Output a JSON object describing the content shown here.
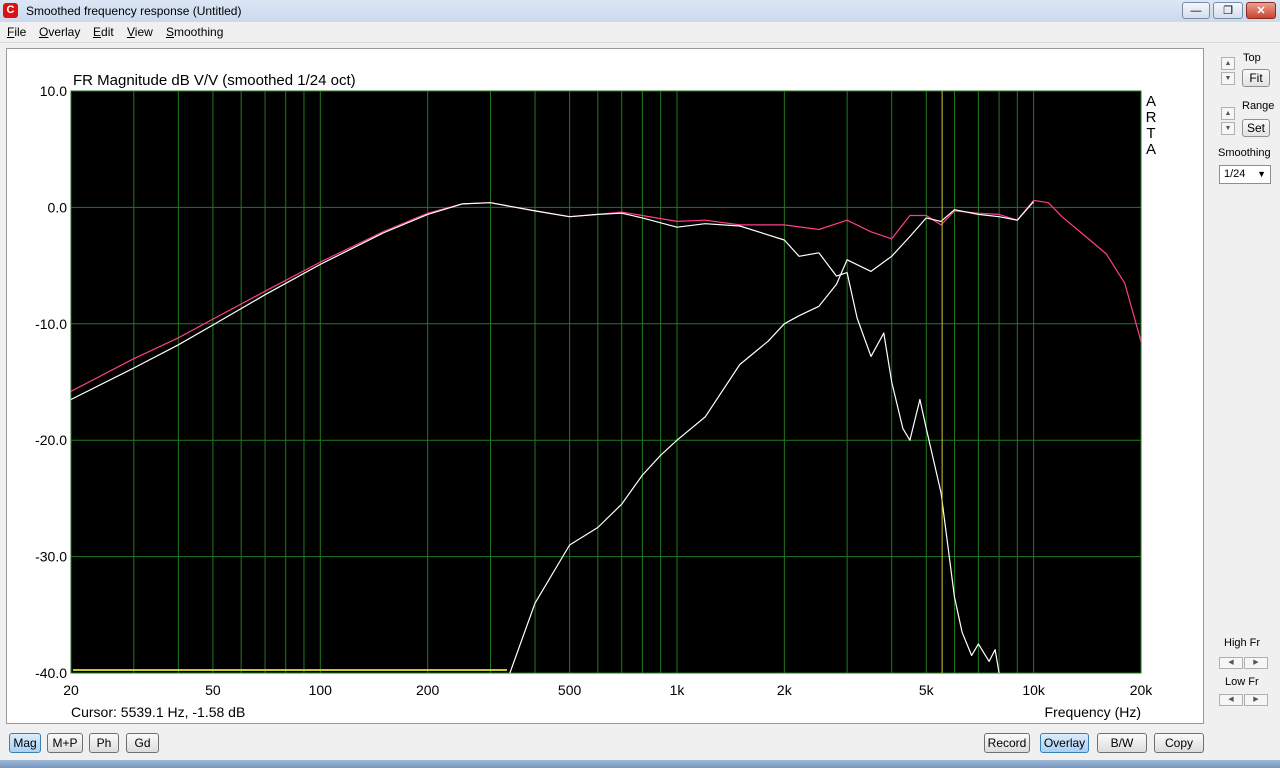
{
  "window": {
    "title": "Smoothed frequency response (Untitled)",
    "minimize": "—",
    "restore": "❐",
    "close": "✕"
  },
  "menu": [
    {
      "label": "File",
      "u": "F",
      "rest": "ile"
    },
    {
      "label": "Overlay",
      "u": "O",
      "rest": "verlay"
    },
    {
      "label": "Edit",
      "u": "E",
      "rest": "dit"
    },
    {
      "label": "View",
      "u": "V",
      "rest": "iew"
    },
    {
      "label": "Smoothing",
      "u": "S",
      "rest": "moothing"
    }
  ],
  "side": {
    "top_label": "Top",
    "fit": "Fit",
    "range_label": "Range",
    "set": "Set",
    "smoothing_label": "Smoothing",
    "smoothing_value": "1/24",
    "high_label": "High Fr",
    "low_label": "Low Fr"
  },
  "bottom_buttons": {
    "mag": "Mag",
    "mp": "M+P",
    "ph": "Ph",
    "gd": "Gd",
    "record": "Record",
    "overlay": "Overlay",
    "bw": "B/W",
    "copy": "Copy"
  },
  "status": {
    "cursor": "Cursor: 5539.1 Hz, -1.58 dB"
  },
  "colors": {
    "plot_bg": "#000000",
    "grid": "#1f7a1f",
    "white_curve": "#ffffff",
    "pink_curve": "#ff3c8c",
    "cursor": "#c8c832",
    "lowfr_marker": "#c8c832"
  },
  "chart_data": {
    "type": "line",
    "title": "FR Magnitude dB V/V (smoothed 1/24 oct)",
    "xlabel": "Frequency (Hz)",
    "ylabel": "",
    "xscale": "log",
    "xlim": [
      20,
      20000
    ],
    "ylim": [
      -40,
      10
    ],
    "x_ticks": [
      20,
      50,
      100,
      200,
      500,
      1000,
      2000,
      5000,
      10000,
      20000
    ],
    "x_tick_labels": [
      "20",
      "50",
      "100",
      "200",
      "500",
      "1k",
      "2k",
      "5k",
      "10k",
      "20k"
    ],
    "y_ticks": [
      10,
      0,
      -10,
      -20,
      -30,
      -40
    ],
    "y_tick_labels": [
      "10.0",
      "0.0",
      "-10.0",
      "-20.0",
      "-30.0",
      "-40.0"
    ],
    "watermark": [
      "A",
      "R",
      "T",
      "A"
    ],
    "cursor_x": 5539.1,
    "series": [
      {
        "color": "#ff3c8c",
        "x": [
          20,
          30,
          40,
          50,
          70,
          100,
          150,
          200,
          250,
          300,
          400,
          500,
          600,
          700,
          800,
          1000,
          1200,
          1500,
          2000,
          2500,
          3000,
          3500,
          4000,
          4500,
          5000,
          5500,
          6000,
          7000,
          8000,
          9000,
          10000,
          11000,
          12000,
          14000,
          16000,
          18000,
          20000
        ],
        "values": [
          -15.8,
          -13.0,
          -11.2,
          -9.6,
          -7.2,
          -4.7,
          -2.1,
          -0.5,
          0.3,
          0.4,
          -0.3,
          -0.8,
          -0.6,
          -0.4,
          -0.7,
          -1.2,
          -1.1,
          -1.5,
          -1.5,
          -1.9,
          -1.1,
          -2.1,
          -2.7,
          -0.7,
          -0.7,
          -1.5,
          -0.3,
          -0.5,
          -0.6,
          -1.1,
          0.6,
          0.4,
          -0.8,
          -2.5,
          -4.0,
          -6.5,
          -11.5
        ]
      },
      {
        "color": "#ffffff",
        "x": [
          20,
          30,
          40,
          50,
          70,
          100,
          150,
          200,
          250,
          300,
          400,
          500,
          600,
          700,
          800,
          1000,
          1200,
          1500,
          2000,
          2200,
          2500,
          2800,
          3000,
          3200,
          3500,
          3800,
          4000,
          4300,
          4500,
          4800,
          5000,
          5500,
          6000,
          6300,
          6700,
          7000,
          7500,
          7800,
          8000
        ],
        "values": [
          -16.5,
          -13.8,
          -11.8,
          -10.1,
          -7.5,
          -4.9,
          -2.2,
          -0.6,
          0.3,
          0.4,
          -0.3,
          -0.8,
          -0.6,
          -0.5,
          -0.9,
          -1.7,
          -1.4,
          -1.6,
          -2.8,
          -4.2,
          -3.9,
          -5.9,
          -5.6,
          -9.5,
          -12.8,
          -10.8,
          -15.0,
          -19.0,
          -20.0,
          -16.5,
          -19.0,
          -24.5,
          -33.5,
          -36.5,
          -38.5,
          -37.5,
          -39.0,
          -38.0,
          -40.0
        ]
      },
      {
        "color": "#ffffff",
        "x": [
          340,
          400,
          500,
          600,
          700,
          800,
          900,
          1000,
          1200,
          1500,
          1800,
          2000,
          2200,
          2500,
          2800,
          3000,
          3500,
          4000,
          4500,
          5000,
          5500,
          6000,
          7000,
          8000,
          9000,
          10000
        ],
        "values": [
          -40.0,
          -34.0,
          -29.0,
          -27.5,
          -25.5,
          -23.0,
          -21.3,
          -20.0,
          -18.0,
          -13.5,
          -11.5,
          -10.0,
          -9.3,
          -8.5,
          -6.6,
          -4.5,
          -5.5,
          -4.2,
          -2.5,
          -0.9,
          -1.2,
          -0.2,
          -0.6,
          -0.8,
          -1.1,
          0.5
        ]
      }
    ]
  }
}
